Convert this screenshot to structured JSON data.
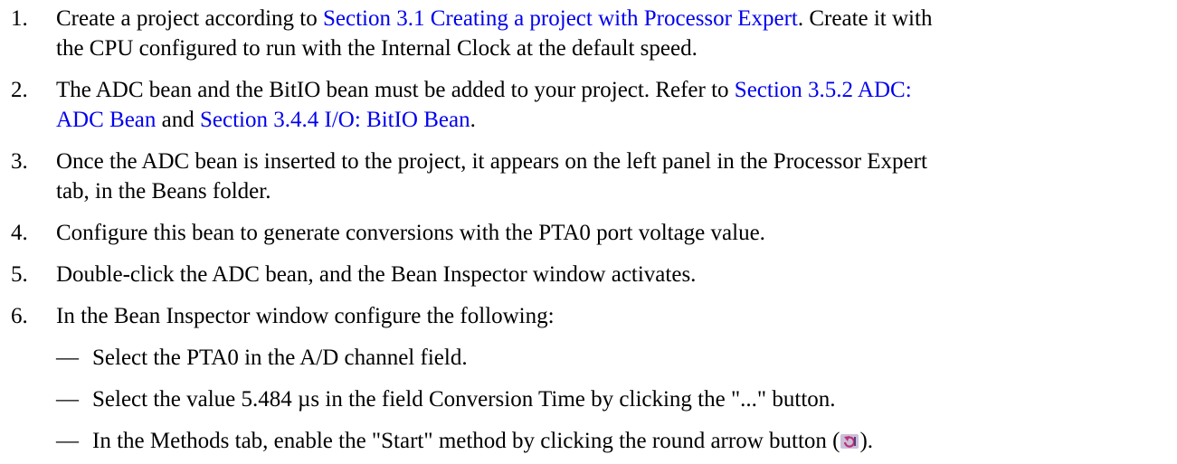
{
  "steps": [
    {
      "number": "1.",
      "pre": "Create a project according to ",
      "link": "Section 3.1 Creating a project with Processor Expert",
      "post": ". Create it with",
      "line2": "the CPU configured to run with the Internal Clock at the default speed."
    },
    {
      "number": "2.",
      "pre": "The ADC bean and the BitIO bean must be added to your project. Refer to ",
      "link1a": "Section 3.5.2 ADC:",
      "link1b": "ADC Bean",
      "mid": " and ",
      "link2": "Section 3.4.4 I/O: BitIO Bean",
      "post": "."
    },
    {
      "number": "3.",
      "line1": "Once the ADC bean is inserted to the project, it appears on the left panel in the Processor Expert",
      "line2": "tab, in the Beans folder."
    },
    {
      "number": "4.",
      "line1": "Configure this bean to generate conversions with the PTA0 port voltage value."
    },
    {
      "number": "5.",
      "line1": "Double-click the ADC bean, and the Bean Inspector window activates."
    },
    {
      "number": "6.",
      "line1": "In the Bean Inspector window configure the following:"
    }
  ],
  "subitems": {
    "dash": "—",
    "item1": "Select the PTA0 in the A/D channel field.",
    "item2": "Select the value 5.484 µs in the field Conversion Time by clicking the \"...\" button.",
    "item3_pre": "In the Methods tab, enable the \"Start\" method by clicking the round arrow button (",
    "item3_post": ")."
  }
}
